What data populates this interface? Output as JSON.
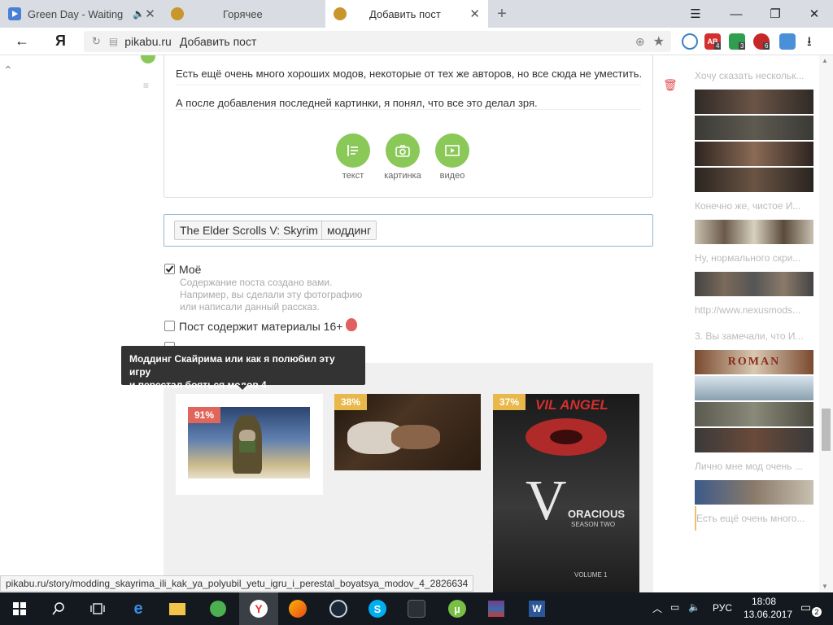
{
  "tabs": [
    {
      "title": "Green Day - Waiting",
      "favicon": "media-play-icon",
      "color": "#4a7fd6"
    },
    {
      "title": "Горячее",
      "favicon": "pikabu-icon",
      "color": "#c8962a"
    },
    {
      "title": "Добавить пост",
      "favicon": "pikabu-icon",
      "color": "#c8962a"
    }
  ],
  "toolbar": {
    "url_domain": "pikabu.ru",
    "url_title": "Добавить пост",
    "yandex_logo": "Я"
  },
  "editor": {
    "paragraph1": "Есть ещё очень много хороших модов, некоторые от тех же авторов, но все сюда не уместить.",
    "paragraph2": "А после добавления последней картинки, я понял, что все это делал зря.",
    "add_text": "текст",
    "add_image": "картинка",
    "add_video": "видео"
  },
  "tags": [
    "The Elder Scrolls V: Skyrim",
    "моддинг"
  ],
  "options": {
    "mine_label": "Моё",
    "mine_hint_1": "Содержание поста создано вами.",
    "mine_hint_2": "Например, вы сделали эту фотографию",
    "mine_hint_3": "или написали данный рассказ.",
    "adult_label": "Пост содержит материалы 16+"
  },
  "tooltip": {
    "line1": "Моддинг Скайрима или как я полюбил эту игру",
    "line2": "и перестал бояться модов 4"
  },
  "similar": [
    {
      "percent": "91%",
      "badge_color": "#e0655a"
    },
    {
      "percent": "38%",
      "badge_color": "#e8b84a"
    },
    {
      "percent": "37%",
      "badge_color": "#e8b84a"
    }
  ],
  "poster": {
    "title": "VIL ANGEL",
    "name": "ORACIOUS",
    "season": "SEASON TWO",
    "volume": "VOLUME 1"
  },
  "sidebar": {
    "items": [
      "Хочу сказать нескольк...",
      "Конечно же, чистое И...",
      "Ну, нормального скри...",
      "http://www.nexusmods...",
      "3. Вы замечали, что И...",
      "Лично мне мод очень ...",
      "Есть ещё очень много..."
    ],
    "roman_text": "ROMAN"
  },
  "statusbar": {
    "url": "pikabu.ru/story/modding_skayrima_ili_kak_ya_polyubil_yetu_igru_i_perestal_boyatsya_modov_4_2826634"
  },
  "taskbar": {
    "language": "РУС",
    "time": "18:08",
    "date": "13.06.2017",
    "notification_count": "2"
  },
  "extensions": [
    {
      "badge": "4",
      "color": "#d32f2f"
    },
    {
      "badge": "3",
      "color": "#2e9e4f"
    },
    {
      "badge": "6",
      "color": "#c62828"
    }
  ]
}
